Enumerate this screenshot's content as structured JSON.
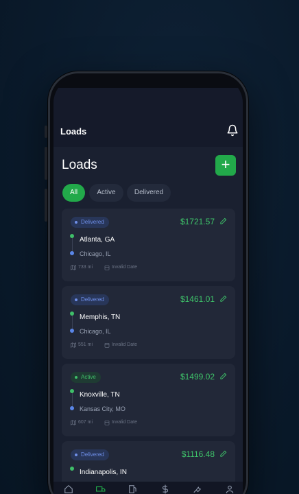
{
  "app": {
    "header_title": "Loads",
    "page_title": "Loads",
    "add_label": "+"
  },
  "tabs": [
    {
      "label": "All",
      "selected": true
    },
    {
      "label": "Active",
      "selected": false
    },
    {
      "label": "Delivered",
      "selected": false
    }
  ],
  "loads": [
    {
      "status": "Delivered",
      "price": "$1721.57",
      "origin": "Atlanta, GA",
      "destination": "Chicago, IL",
      "distance": "733 mi",
      "date": "Invalid Date"
    },
    {
      "status": "Delivered",
      "price": "$1461.01",
      "origin": "Memphis, TN",
      "destination": "Chicago, IL",
      "distance": "551 mi",
      "date": "Invalid Date"
    },
    {
      "status": "Active",
      "price": "$1499.02",
      "origin": "Knoxville, TN",
      "destination": "Kansas City, MO",
      "distance": "607 mi",
      "date": "Invalid Date"
    },
    {
      "status": "Delivered",
      "price": "$1116.48",
      "origin": "Indianapolis, IN",
      "destination": "",
      "distance": "",
      "date": ""
    }
  ],
  "nav": {
    "items": [
      "home-icon",
      "truck-icon",
      "fuel-icon",
      "dollar-icon",
      "wrench-icon",
      "user-icon"
    ],
    "active": "truck-icon"
  },
  "colors": {
    "accent": "#22a94a",
    "price": "#3fc46a",
    "delivered_badge": "#6f8fe8",
    "active_badge": "#3fbf69",
    "background": "#0a1a2b"
  }
}
